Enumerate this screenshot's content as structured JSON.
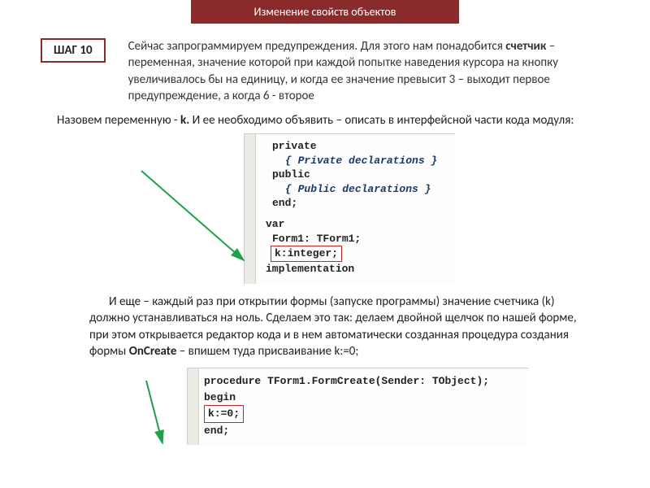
{
  "header": {
    "title": "Изменение свойств объектов"
  },
  "step": {
    "label": "ШАГ 10",
    "text_before": "Сейчас запрограммируем предупреждения. Для этого нам понадобится ",
    "bold1": "счетчик",
    "text_after": " – переменная, значение которой при каждой попытке наведения курсора на кнопку увеличивалось бы на единицу, и когда ее значение превысит 3 – выходит первое предупреждение, а когда 6 - второе"
  },
  "para2": {
    "t1": "Назовем переменную  - ",
    "kvar": "k.",
    "t2": " И ее необходимо объявить – описать в интерфейсной части кода модуля:"
  },
  "code1": {
    "l1": "private",
    "l2": "{ Private declarations }",
    "l3": "public",
    "l4": "{ Public declarations }",
    "l5": "end;",
    "l6": "var",
    "l7": "Form1: TForm1;",
    "l8": "k:integer;",
    "l9": "implementation"
  },
  "para3": {
    "t1": "И еще – каждый раз при открытии формы (запуске программы) значение счетчика (k) должно устанавливаться на ноль. Сделаем это так: делаем двойной щелчок по нашей форме, при этом открывается редактор кода и в нем автоматически созданная процедура создания формы ",
    "bold": "OnCreate",
    "t2": " – впишем туда присваивание k:=0;"
  },
  "code2": {
    "l1": "procedure TForm1.FormCreate(Sender: TObject);",
    "l2": "begin",
    "l3": "k:=0;",
    "l4": "end;"
  }
}
